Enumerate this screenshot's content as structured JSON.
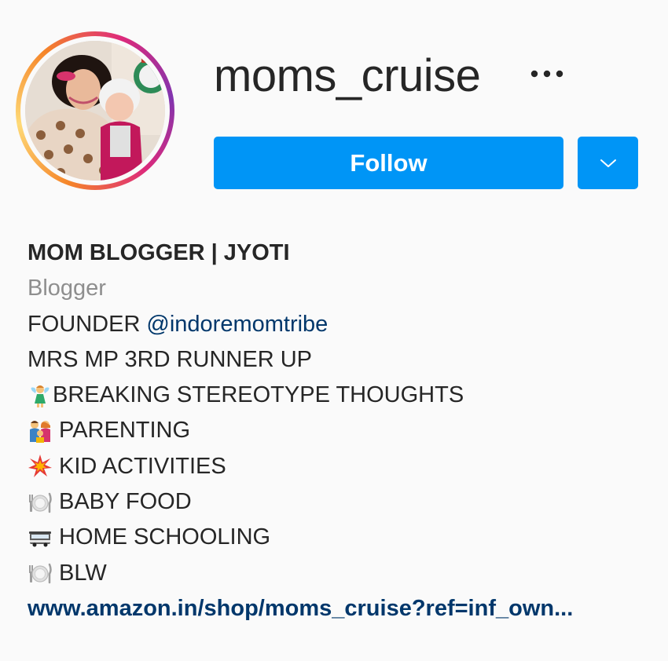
{
  "profile": {
    "username": "moms_cruise",
    "follow_label": "Follow",
    "more_icon": "more-horizontal-icon",
    "dropdown_icon": "chevron-down-icon",
    "accent_color": "#0095f6",
    "link_color": "#00376b"
  },
  "bio": {
    "full_name": "MOM BLOGGER | JYOTI",
    "category": "Blogger",
    "founder_prefix": "FOUNDER",
    "founder_mention": "@indoremomtribe",
    "lines": [
      {
        "icon": "",
        "text": "MRS MP 3RD RUNNER UP"
      },
      {
        "icon": "fairy-emoji-icon",
        "text": "BREAKING STEREOTYPE THOUGHTS"
      },
      {
        "icon": "family-emoji-icon",
        "text": "PARENTING"
      },
      {
        "icon": "collision-emoji-icon",
        "text": "KID ACTIVITIES"
      },
      {
        "icon": "plate-cutlery-emoji-icon",
        "text": "BABY FOOD"
      },
      {
        "icon": "school-bus-emoji-icon",
        "text": "HOME SCHOOLING"
      },
      {
        "icon": "plate-cutlery-emoji-icon",
        "text": "BLW"
      }
    ],
    "website": "www.amazon.in/shop/moms_cruise?ref=inf_own..."
  }
}
